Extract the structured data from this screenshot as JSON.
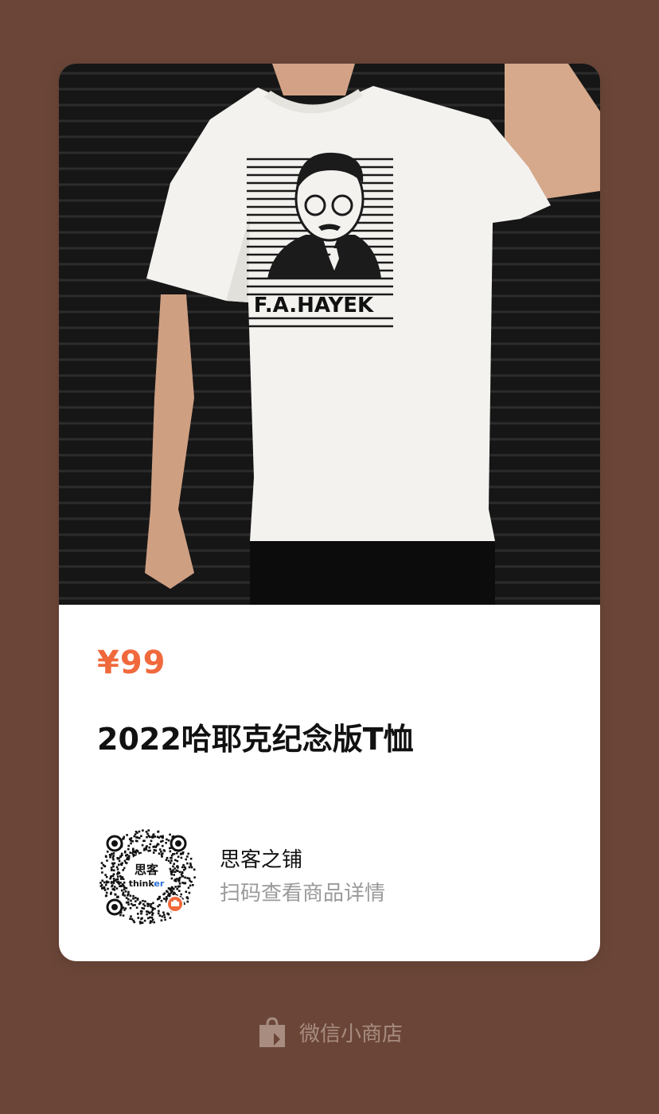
{
  "product": {
    "price": "¥99",
    "title": "2022哈耶克纪念版T恤",
    "shirt_print_text": "F.A.HAYEK",
    "image": "product-photo-white-tshirt"
  },
  "shop": {
    "name": "思客之铺",
    "hint": "扫码查看商品详情",
    "qr_logo_top": "思客",
    "qr_logo_bottom_a": "think",
    "qr_logo_bottom_b": "er"
  },
  "footer": {
    "icon": "shopping-bag-icon",
    "label": "微信小商店"
  },
  "colors": {
    "background": "#6B4638",
    "price": "#F0693C",
    "accent_qr_badge": "#F0693C",
    "footer_text": "#A88C80"
  }
}
